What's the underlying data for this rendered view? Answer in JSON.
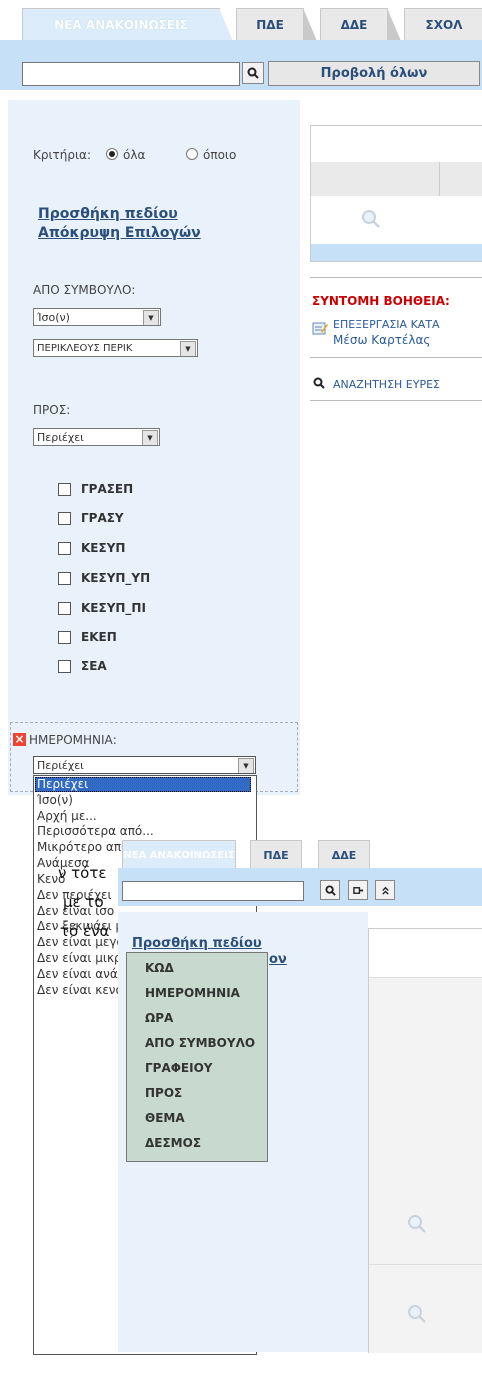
{
  "tabs": [
    "ΝΕΑ ΑΝΑΚΟΙΝΩΣΕΙΣ",
    "ΠΔΕ",
    "ΔΔΕ",
    "ΣΧΟΛ"
  ],
  "toolbar": {
    "view_all_label": "Προβολή όλων",
    "search_value": ""
  },
  "criteria": {
    "label": "Κριτήρια:",
    "option_all": "όλα",
    "option_any": "όποιο"
  },
  "links": {
    "add_field": "Προσθήκη πεδίου",
    "hide_options": "Απόκρυψη Επιλογών"
  },
  "from_board": {
    "label": "ΑΠΟ ΣΥΜΒΟΥΛΟ:",
    "operator": "Ίσο(ν)",
    "value": "ΠΕΡΙΚΛΕΟΥΣ ΠΕΡΙΚ"
  },
  "to": {
    "label": "ΠΡΟΣ:",
    "operator": "Περιέχει",
    "options": [
      "ΓΡΑΣΕΠ",
      "ΓΡΑΣΥ",
      "ΚΕΣΥΠ",
      "ΚΕΣΥΠ_ΥΠ",
      "ΚΕΣΥΠ_ΠΙ",
      "ΕΚΕΠ",
      "ΣΕΑ"
    ]
  },
  "date": {
    "label": "ΗΜΕΡΟΜΗΝΙΑ:",
    "operator": "Περιέχει",
    "dropdown": [
      "Περιέχει",
      "Ίσο(ν)",
      "Αρχή με...",
      "Περισσότερα από...",
      "Μικρότερο από...",
      "Ανάμεσα",
      "Κενό",
      "Δεν περιέχει",
      "Δεν είναι ίσο",
      "Δεν ξεκινάει με",
      "Δεν είναι μεγαλύτερο από",
      "Δεν είναι μικρότερο από",
      "Δεν είναι ανάμεσα σε",
      "Δεν είναι κενό"
    ]
  },
  "help": {
    "title": "ΣΥΝΤΟΜΗ ΒΟΗΘΕΙΑ:",
    "edit_link_line1": "ΕΠΕΞΕΡΓΑΣΙΑ ΚΑΤΑ",
    "edit_link_line2": "Μέσω Καρτέλας",
    "search_link": "ΑΝΑΖΗΤΗΣΗ ΕΥΡΕΣ"
  },
  "paragraph": {
    "line1": "ν τότε",
    "line2": "με το",
    "line3": "τό ένα"
  },
  "second": {
    "tabs": [
      "ΝΕΑ ΑΝΑΚΟΙΝΩΣΕΙΣ",
      "ΠΔΕ",
      "ΔΔΕ"
    ],
    "add_field": "Προσθήκη πεδίου",
    "hidden_partial": "ον",
    "field_menu": [
      "ΚΩΔ",
      "ΗΜΕΡΟΜΗΝΙΑ",
      "ΩΡΑ",
      "ΑΠΟ ΣΥΜΒΟΥΛΟ",
      "ΓΡΑΦΕΙΟΥ",
      "ΠΡΟΣ",
      "ΘΕΜΑ",
      "ΔΕΣΜΟΣ"
    ]
  },
  "colors": {
    "accent": "#2b4f7a",
    "toolbar": "#c6e0f7",
    "panel": "#e9f2fb",
    "help": "#cc0000",
    "selection": "#316ac5"
  }
}
